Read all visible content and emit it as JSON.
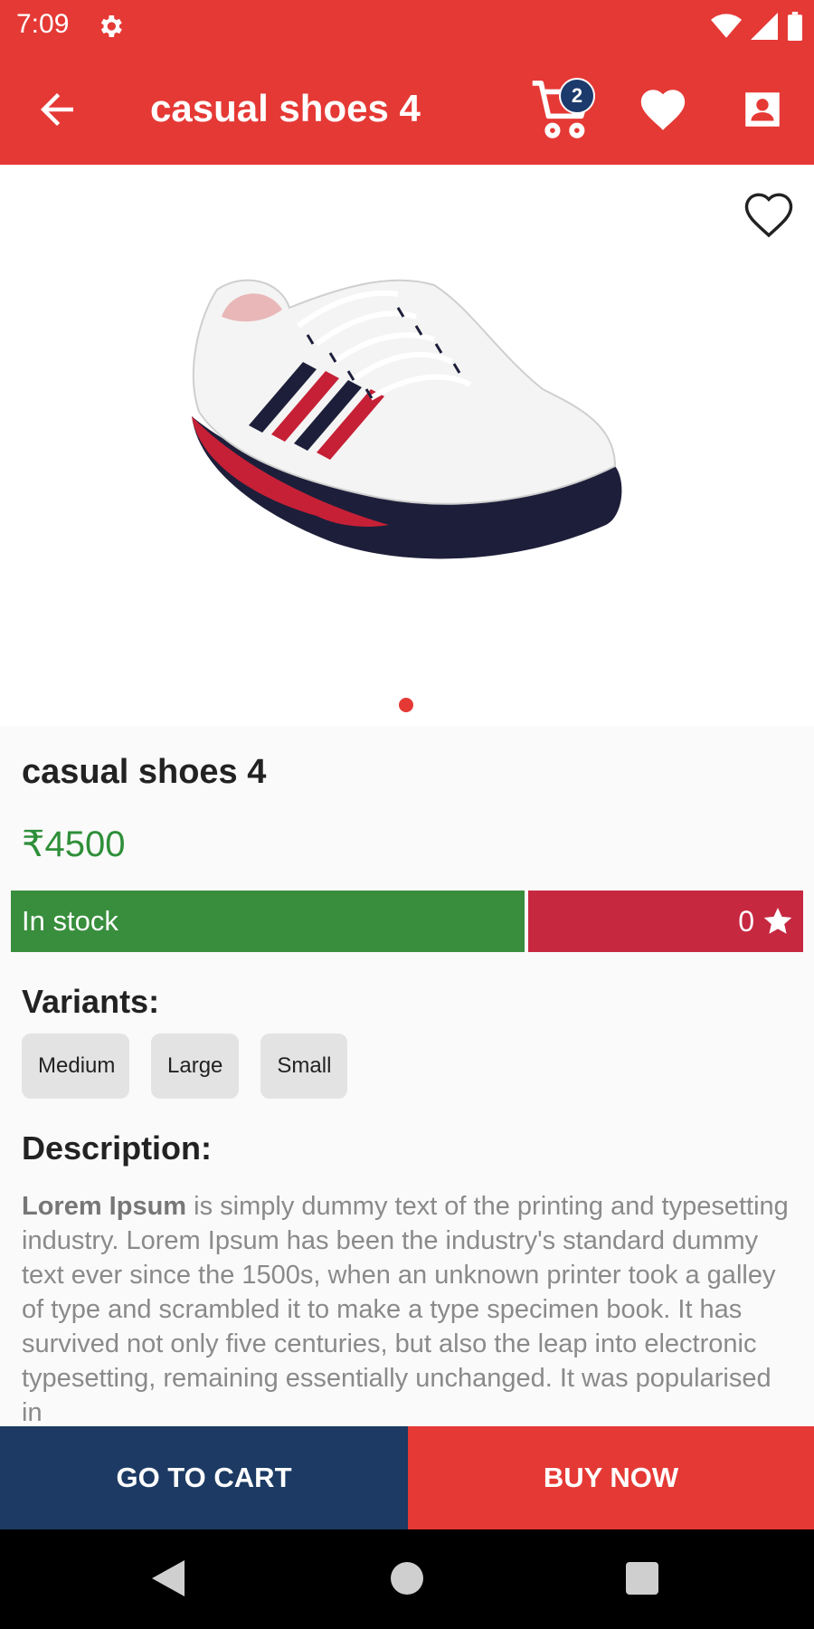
{
  "status_bar": {
    "time": "7:09"
  },
  "app_bar": {
    "title": "casual shoes 4",
    "cart_count": "2"
  },
  "product": {
    "name": "casual shoes 4",
    "price": "₹4500",
    "stock_status": "In stock",
    "rating": "0"
  },
  "variants": {
    "heading": "Variants:",
    "options": [
      "Medium",
      "Large",
      "Small"
    ]
  },
  "description": {
    "heading": "Description:",
    "lead": "Lorem Ipsum",
    "body": " is simply dummy text of the printing and typesetting industry. Lorem Ipsum has been the industry's standard dummy text ever since the 1500s, when an unknown printer took a galley of type and scrambled it to make a type specimen book. It has survived not only five centuries, but also the leap into electronic typesetting, remaining essentially unchanged. It was popularised in"
  },
  "actions": {
    "go_to_cart": "GO TO CART",
    "buy_now": "BUY NOW"
  },
  "colors": {
    "primary": "#e53935",
    "navy": "#1c3a63",
    "in_stock": "#388e3c",
    "rating_bg": "#c62840",
    "price": "#2f8f3a"
  },
  "icons": [
    "gear-icon",
    "wifi-icon",
    "signal-icon",
    "battery-icon",
    "back-arrow-icon",
    "cart-icon",
    "heart-icon",
    "profile-icon",
    "heart-outline-icon",
    "star-icon",
    "nav-back-icon",
    "nav-home-icon",
    "nav-recents-icon"
  ]
}
